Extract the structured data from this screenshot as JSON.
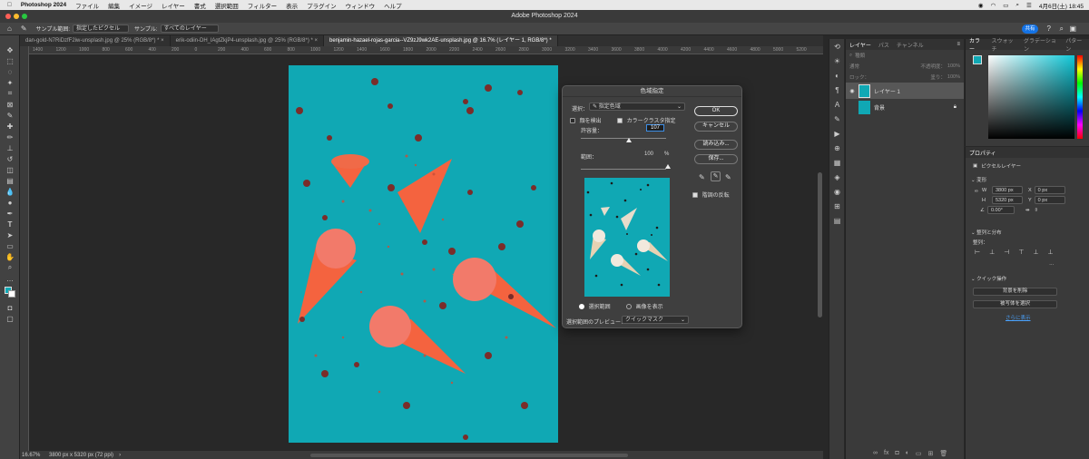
{
  "menubar": {
    "app": "Photoshop 2024",
    "items": [
      "ファイル",
      "編集",
      "イメージ",
      "レイヤー",
      "書式",
      "選択範囲",
      "フィルター",
      "表示",
      "プラグイン",
      "ウィンドウ",
      "ヘルプ"
    ],
    "datetime": "4月6日(土) 18:45"
  },
  "window": {
    "title": "Adobe Photoshop 2024"
  },
  "options": {
    "sample_size_label": "サンプル範囲:",
    "sample_size_value": "指定したピクセル",
    "sample_label": "サンプル:",
    "sample_value": "すべてのレイヤー",
    "share_label": "共有"
  },
  "tabs": [
    {
      "label": "dan-gold-N7RiDzfF2iw-unsplash.jpg @ 25% (RGB/8*) *"
    },
    {
      "label": "erik-odiin-DH_lAgtZkjP4-unsplash.jpg @ 25% (RGB/8*) *"
    },
    {
      "label": "benjamin-hazael-rojas-garcia--VZ9zJ9wk2AE-unsplash.jpg @ 16.7% (レイヤー 1, RGB/8*) *"
    }
  ],
  "ruler": {
    "ticks": [
      "1400",
      "1200",
      "1000",
      "800",
      "600",
      "400",
      "200",
      "0",
      "200",
      "400",
      "600",
      "800",
      "1000",
      "1200",
      "1400",
      "1600",
      "1800",
      "2000",
      "2200",
      "2400",
      "2600",
      "2800",
      "3000",
      "3200",
      "3400",
      "3600",
      "3800",
      "4000",
      "4200",
      "4400",
      "4600",
      "4800",
      "5000",
      "5200"
    ]
  },
  "status": {
    "zoom": "16.67%",
    "doc_info": "3800 px x 5320 px (72 ppi)"
  },
  "dialog": {
    "title": "色域指定",
    "select_label": "選択：",
    "select_value": "指定色域",
    "detect_faces": "顔を検出",
    "localized_clusters": "カラークラスタ指定",
    "fuzziness_label": "許容量：",
    "fuzziness_value": "107",
    "range_label": "範囲：",
    "range_value": "100",
    "range_unit": "%",
    "radio_selection": "選択範囲",
    "radio_image": "画像を表示",
    "preview_label": "選択範囲のプレビュー：",
    "preview_value": "クイックマスク",
    "invert_label": "階調の反転",
    "ok": "OK",
    "cancel": "キャンセル",
    "load": "読み込み...",
    "save": "保存..."
  },
  "layers_panel": {
    "tabs": [
      "レイヤー",
      "パス",
      "チャンネル"
    ],
    "search_placeholder": "種類",
    "blend_mode": "通常",
    "opacity_label": "不透明度：",
    "opacity_value": "100%",
    "lock_label": "ロック：",
    "fill_label": "塗り：",
    "fill_value": "100%",
    "layers": [
      {
        "name": "レイヤー 1",
        "selected": true
      },
      {
        "name": "背景",
        "selected": false
      }
    ]
  },
  "color_panel": {
    "tabs": [
      "カラー",
      "スウォッチ",
      "グラデーション",
      "パターン"
    ]
  },
  "properties_panel": {
    "title": "プロパティ",
    "pixel_layer": "ピクセルレイヤー",
    "transform": "変形",
    "w_label": "W",
    "w_value": "3800 px",
    "h_label": "H",
    "h_value": "5320 px",
    "x_label": "X",
    "x_value": "0 px",
    "y_label": "Y",
    "y_value": "0 px",
    "angle_value": "0.00°",
    "align_title": "整列と分布",
    "align_label": "整列：",
    "quick_actions": "クイック操作",
    "remove_bg": "背景を削除",
    "select_subject": "被写体を選択",
    "more": "さらに表示"
  },
  "colors": {
    "photo_bg": "#10a8b4",
    "cone": "#f4633f",
    "accent_blue": "#1473e6"
  }
}
